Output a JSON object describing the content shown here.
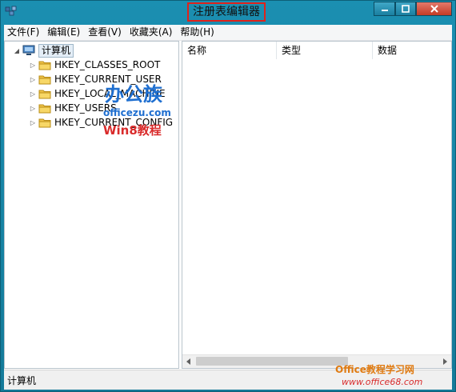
{
  "window": {
    "title": "注册表编辑器",
    "icon": "regedit-icon",
    "controls": [
      "minimize-icon",
      "maximize-icon",
      "close-icon"
    ]
  },
  "menu": {
    "items": [
      "文件(F)",
      "编辑(E)",
      "查看(V)",
      "收藏夹(A)",
      "帮助(H)"
    ]
  },
  "tree": {
    "root": "计算机",
    "keys": [
      "HKEY_CLASSES_ROOT",
      "HKEY_CURRENT_USER",
      "HKEY_LOCAL_MACHINE",
      "HKEY_USERS",
      "HKEY_CURRENT_CONFIG"
    ]
  },
  "list": {
    "columns": [
      "名称",
      "类型",
      "数据"
    ]
  },
  "status": {
    "text": "计算机"
  },
  "watermarks": {
    "center": [
      "办公族",
      "officezu.com",
      "Win8教程"
    ],
    "corner": [
      "Office教程学习网",
      "www.office68.com"
    ]
  },
  "colors": {
    "titlebar": "#1b8fb1",
    "title_highlight": "#e0221b",
    "close_button": "#c43b25",
    "watermark_blue": "#1f6fd0",
    "watermark_red": "#d92b2b"
  }
}
